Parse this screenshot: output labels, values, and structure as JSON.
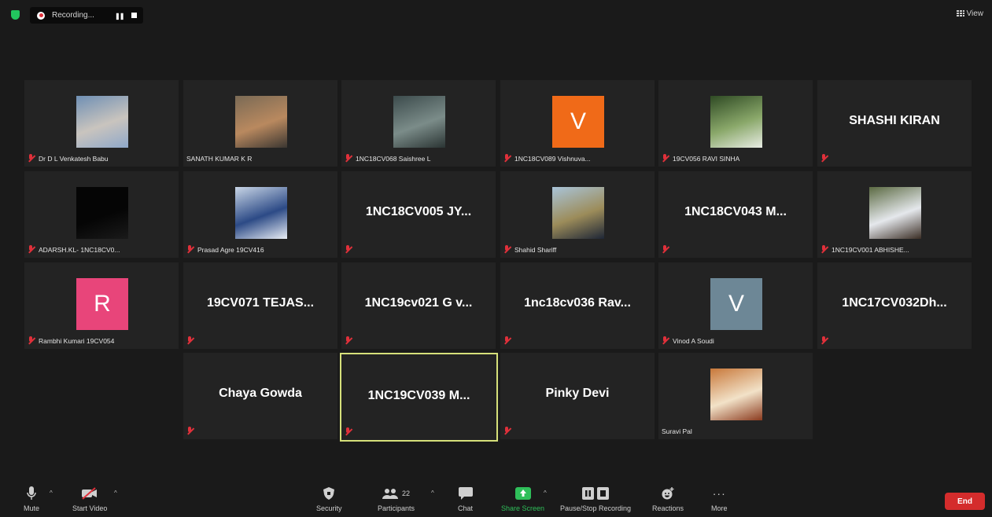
{
  "top_bar": {
    "recording_label": "Recording...",
    "pause_glyph": "❚❚",
    "view_label": "View"
  },
  "tiles": [
    {
      "name": "Dr D L Venkatesh Babu",
      "display": "photo",
      "muted": true,
      "colors": [
        "#6f8fb4",
        "#c9c4be",
        "#8fa8c9"
      ]
    },
    {
      "name": "SANATH KUMAR K R",
      "display": "photo",
      "muted": false,
      "colors": [
        "#7a6a55",
        "#b9895f",
        "#3b3631"
      ]
    },
    {
      "name": "1NC18CV068 Saishree L",
      "display": "photo",
      "muted": true,
      "colors": [
        "#3c4b4c",
        "#7b8c89",
        "#2a3433"
      ]
    },
    {
      "name": "1NC18CV089 Vishnuva...",
      "display": "letter",
      "letter": "V",
      "bg": "#f06a18",
      "muted": true
    },
    {
      "name": "19CV056 RAVI SINHA",
      "display": "photo",
      "muted": true,
      "colors": [
        "#2f4a24",
        "#8aa86a",
        "#e8ece4"
      ]
    },
    {
      "name": "",
      "big": "SHASHI KIRAN",
      "display": "name",
      "muted": true
    },
    {
      "name": "ADARSH.KL- 1NC18CV0...",
      "display": "photo",
      "muted": true,
      "colors": [
        "#050505",
        "#050505",
        "#1a1a1a"
      ]
    },
    {
      "name": "Prasad Agre 19CV416",
      "display": "photo",
      "muted": true,
      "colors": [
        "#c9d6e6",
        "#2c4a86",
        "#e9eef5"
      ]
    },
    {
      "name": "",
      "big": "1NC18CV005 JY...",
      "display": "name",
      "muted": true
    },
    {
      "name": "Shahid Shariff",
      "display": "photo",
      "muted": true,
      "colors": [
        "#a9c4d9",
        "#9c8c5a",
        "#1e2636"
      ]
    },
    {
      "name": "",
      "big": "1NC18CV043 M...",
      "display": "name",
      "muted": true
    },
    {
      "name": "1NC19CV001 ABHISHE...",
      "display": "photo",
      "muted": true,
      "colors": [
        "#5b6a42",
        "#e5e8ec",
        "#3a2d24"
      ]
    },
    {
      "name": "Rambhi Kumari 19CV054",
      "display": "letter",
      "letter": "R",
      "bg": "#e8457a",
      "muted": true
    },
    {
      "name": "",
      "big": "19CV071 TEJAS...",
      "display": "name",
      "muted": true
    },
    {
      "name": "",
      "big": "1NC19cv021 G v...",
      "display": "name",
      "muted": true
    },
    {
      "name": "",
      "big": "1nc18cv036 Rav...",
      "display": "name",
      "muted": true
    },
    {
      "name": "Vinod A Soudi",
      "display": "letter",
      "letter": "V",
      "bg": "#6d8796",
      "muted": true
    },
    {
      "name": "",
      "big": "1NC17CV032Dh...",
      "display": "name",
      "muted": true
    },
    {
      "name": "",
      "big": "Chaya Gowda",
      "display": "name",
      "muted": true
    },
    {
      "name": "",
      "big": "1NC19CV039 M...",
      "display": "name",
      "muted": true,
      "active": true
    },
    {
      "name": "",
      "big": "Pinky Devi",
      "display": "name",
      "muted": true
    },
    {
      "name": "Suravi Pal",
      "display": "photo",
      "muted": false,
      "colors": [
        "#c8783a",
        "#f2e2c8",
        "#8b3a1e"
      ]
    }
  ],
  "toolbar": {
    "mute": "Mute",
    "start_video": "Start Video",
    "security": "Security",
    "participants": "Participants",
    "participants_count": "22",
    "chat": "Chat",
    "share_screen": "Share Screen",
    "pause_stop": "Pause/Stop Recording",
    "reactions": "Reactions",
    "more": "More",
    "end": "End",
    "caret_glyph": "^",
    "more_glyph": "···"
  },
  "colors": {
    "background": "#1a1a1a",
    "tile": "#232323",
    "share_green": "#2fbf5a",
    "end_red": "#d42c2c",
    "active_border": "#d6e07a",
    "muted_red": "#e0303a"
  }
}
